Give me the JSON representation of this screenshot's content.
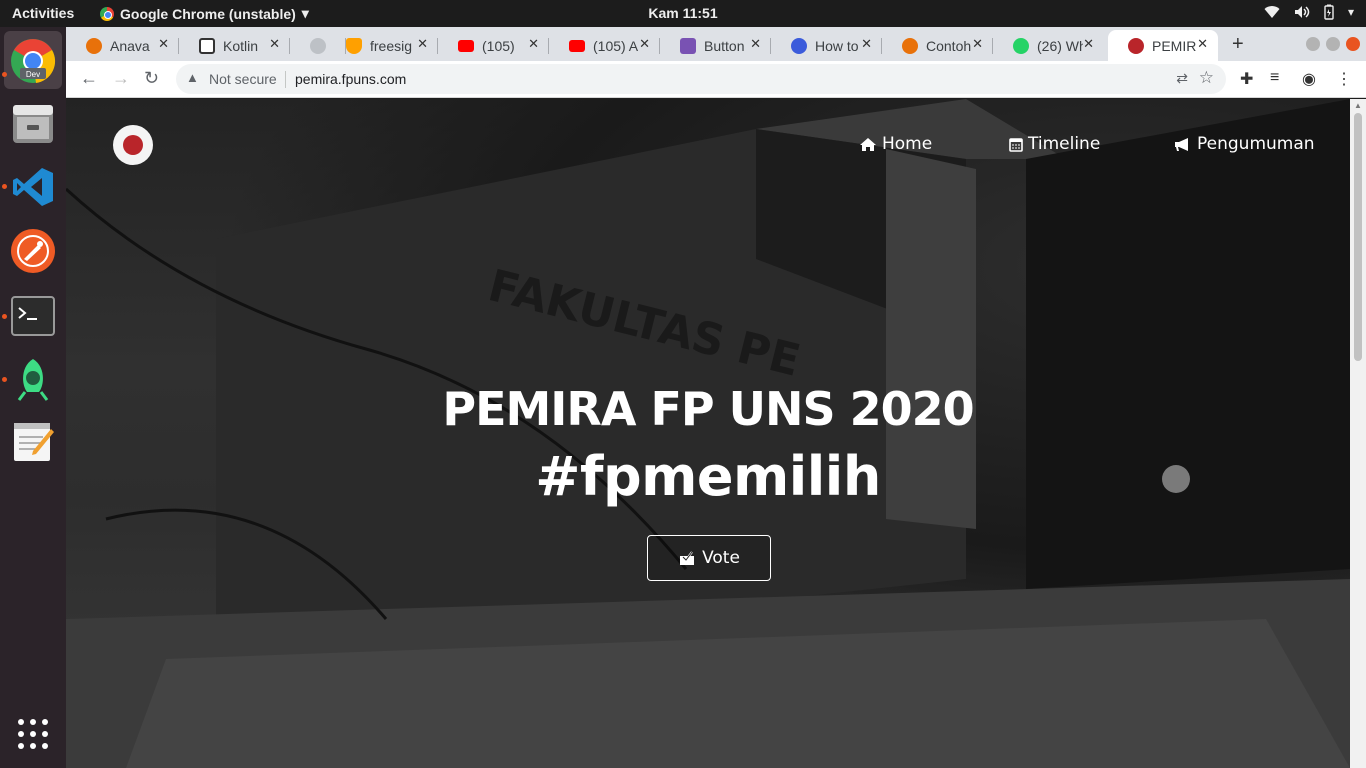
{
  "topbar": {
    "activities": "Activities",
    "app_name": "Google Chrome (unstable)",
    "clock": "Kam 11:51"
  },
  "dock": {
    "items": [
      "chrome-dev",
      "files",
      "vscode",
      "postman",
      "terminal",
      "android-studio",
      "text-editor",
      "show-apps"
    ],
    "chrome_badge": "Dev"
  },
  "tabs": [
    {
      "label": "Anava",
      "color": "#e8710a"
    },
    {
      "label": "Kotlin",
      "color": "#ffffff"
    },
    {
      "label": "",
      "color": "#bdc1c6"
    },
    {
      "label": "freesig",
      "color": "#ffa000"
    },
    {
      "label": "(105)",
      "color": "#ff0000"
    },
    {
      "label": "(105) A",
      "color": "#ff0000"
    },
    {
      "label": "Button",
      "color": "#7952b3"
    },
    {
      "label": "How to",
      "color": "#3b5bdb"
    },
    {
      "label": "Contoh",
      "color": "#e8710a"
    },
    {
      "label": "(26) Wh",
      "color": "#25d366"
    },
    {
      "label": "PEMIR",
      "color": "#b9252a"
    }
  ],
  "omnibox": {
    "security": "Not secure",
    "url": "pemira.fpuns.com"
  },
  "site": {
    "nav": [
      {
        "label": "Home",
        "icon": "home-icon"
      },
      {
        "label": "Timeline",
        "icon": "calendar-icon"
      },
      {
        "label": "Pengumuman",
        "icon": "megaphone-icon"
      }
    ],
    "title": "PEMIRA FP UNS 2020",
    "hashtag": "#fpmemilih",
    "vote_label": "Vote",
    "building_sign": "FAKULTAS PE"
  }
}
